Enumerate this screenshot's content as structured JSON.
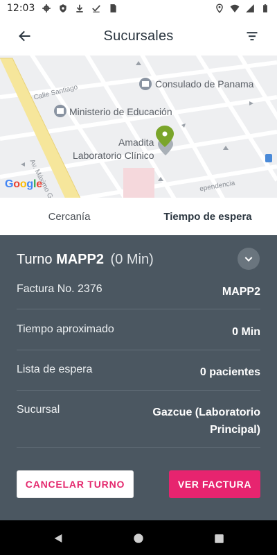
{
  "status_bar": {
    "time": "12:03",
    "left_icons": [
      "gear-icon",
      "shield-icon",
      "download-icon",
      "check-icon",
      "sd-card-icon"
    ],
    "right_icons": [
      "location-icon",
      "wifi-icon",
      "signal-icon",
      "battery-icon"
    ]
  },
  "app_bar": {
    "title": "Sucursales",
    "back_icon": "arrow-left-icon",
    "filter_icon": "filter-icon"
  },
  "map": {
    "labels": {
      "consulado": "Consulado de Panama",
      "calle_santiago": "Calle Santiago",
      "ministerio": "Ministerio de Educación",
      "amadita_1": "Amadita",
      "amadita_2": "Laboratorio Clínico",
      "av_maximo": "Av. Máximo Gomez",
      "independencia": "ependencia"
    },
    "google_letters": [
      "G",
      "o",
      "o",
      "g",
      "l",
      "e"
    ],
    "colors": {
      "pin": "#7aa52a",
      "avenue": "#f6e69b",
      "background": "#eeeff1"
    }
  },
  "tabs": [
    {
      "label": "Cercanía",
      "active": false
    },
    {
      "label": "Tiempo de espera",
      "active": true
    }
  ],
  "turno": {
    "prefix": "Turno",
    "code": "MAPP2",
    "time": "(0 Min)"
  },
  "details": {
    "factura": {
      "label": "Factura No. 2376",
      "value": "MAPP2"
    },
    "tiempo": {
      "label": "Tiempo aproximado",
      "value": "0 Min"
    },
    "lista": {
      "label": "Lista de espera",
      "value": "0 pacientes"
    },
    "sucursal": {
      "label": "Sucursal",
      "value_line1": "Gazcue (Laboratorio",
      "value_line2": "Principal)"
    }
  },
  "actions": {
    "cancel_label": "CANCELAR TURNO",
    "factura_label": "VER FACTURA"
  },
  "colors": {
    "panel": "#4b5761",
    "accent": "#e7246f"
  }
}
